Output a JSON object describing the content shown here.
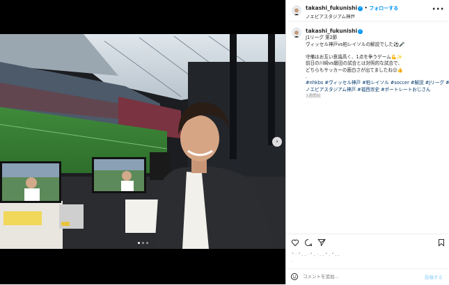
{
  "post": {
    "username": "takashi_fukunishi",
    "follow_label": "フォローする",
    "location": "ノエビアスタジアム神戸",
    "caption_lines": [
      "J1リーグ 第2節",
      "ヴィッセル神戸vs柏レイソルの解説でした⚽🎤",
      "",
      "守備はお互い意識高く、1点を争うゲーム💪✨",
      "前日の川崎vs磐田の試合とは対照的な試合で、",
      "どちらもサッカーの面白さが出てましたね😊👍",
      "."
    ],
    "hashtag_lines": [
      "#nhkbs #ヴィッセル神戸 #柏レイソル #soccer #解説 #Jリーグ #",
      "ノエビアスタジアム神戸 #福西崇史 #ポートレートおじさん"
    ],
    "time_ago": "3週間前",
    "likes_text": "\" · \" , , · \" , · , , \" , \" , , ",
    "likes_sub": "·",
    "comment_placeholder": "コメントを追加...",
    "post_label": "投稿する"
  },
  "icons": {
    "more": "more-icon",
    "like": "heart-icon",
    "comment": "comment-icon",
    "share": "share-icon",
    "save": "bookmark-icon",
    "emoji": "emoji-icon",
    "next": "chevron-right-icon"
  },
  "colors": {
    "accent": "#0095f6",
    "hashtag": "#00376b",
    "muted": "#8e8e8e"
  },
  "carousel": {
    "count": 3,
    "active": 1
  }
}
